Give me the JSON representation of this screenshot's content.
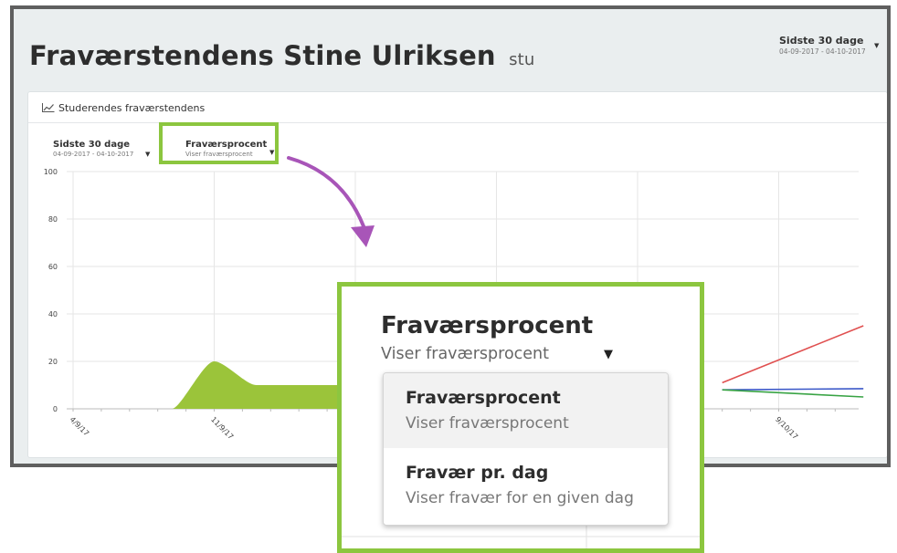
{
  "header": {
    "title": "Fraværstendens Stine Ulriksen",
    "subtitle": "stu",
    "range_label": "Sidste 30 dage",
    "range_dates": "04-09-2017 - 04-10-2017",
    "range_caret": "▼"
  },
  "card": {
    "title": "Studerendes fraværstendens",
    "title_icon": "line-chart-icon",
    "range_dropdown": {
      "label": "Sidste 30 dage",
      "dates": "04-09-2017 - 04-10-2017",
      "caret": "▼"
    },
    "metric_dropdown": {
      "label": "Fraværsprocent",
      "subtitle": "Viser fraværsprocent",
      "caret": "▼"
    }
  },
  "chart_data": {
    "type": "area",
    "y_ticks": [
      "100",
      "80",
      "60",
      "40",
      "20",
      "0"
    ],
    "ylim": [
      0,
      100
    ],
    "x_ticks": [
      "4/9/17",
      "11/9/17",
      "9/10/17"
    ],
    "grid": true,
    "series": [
      {
        "color": "#9bc43a",
        "x": [
          0,
          0.7,
          1,
          1.3,
          1.6,
          3.5
        ],
        "values": [
          0,
          0,
          20,
          10,
          10,
          10
        ]
      },
      {
        "color": "#e05050",
        "x": [
          4.6,
          5.6
        ],
        "values": [
          11,
          35
        ]
      },
      {
        "color": "#3a57c8",
        "x": [
          4.6,
          5.6
        ],
        "values": [
          8,
          8.5
        ]
      },
      {
        "color": "#38a344",
        "x": [
          4.6,
          5.6
        ],
        "values": [
          8,
          5
        ]
      }
    ]
  },
  "zoom": {
    "label": "Fraværsprocent",
    "subtitle": "Viser fraværsprocent",
    "caret": "▼",
    "menu": [
      {
        "title": "Fraværsprocent",
        "subtitle": "Viser fraværsprocent",
        "selected": true
      },
      {
        "title": "Fravær pr. dag",
        "subtitle": "Viser fravær for en given dag",
        "selected": false
      }
    ]
  },
  "colors": {
    "accent": "#8cc63f",
    "arrow": "#a855b8",
    "frame": "#5f5f5f"
  }
}
